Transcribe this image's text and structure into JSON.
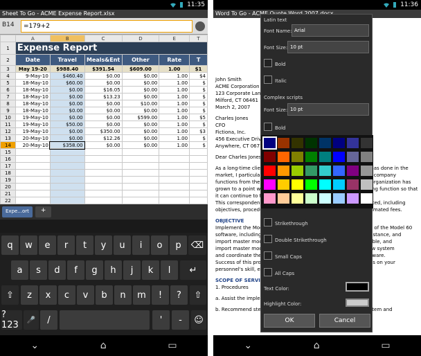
{
  "left": {
    "status_time": "11:35",
    "title": "Sheet To Go - ACME Expense Report.xlsx",
    "cell_ref": "B14",
    "formula": "=179+2",
    "columns": [
      "A",
      "B",
      "C",
      "D",
      "E",
      "T"
    ],
    "rows": [
      {
        "n": "1",
        "c": [
          "Expense Report",
          "",
          "",
          "",
          "",
          ""
        ]
      },
      {
        "n": "2",
        "c": [
          "Date",
          "Travel",
          "Meals&Ent",
          "Other",
          "Rate",
          "T"
        ]
      },
      {
        "n": "3",
        "c": [
          "May 19-20",
          "$988.40",
          "$391.54",
          "$609.00",
          "1.00",
          "$1"
        ]
      },
      {
        "n": "4",
        "c": [
          "9-May-10",
          "$460.40",
          "$0.00",
          "$0.00",
          "1.00",
          "$4"
        ]
      },
      {
        "n": "5",
        "c": [
          "18-May-10",
          "$60.00",
          "$0.00",
          "$0.00",
          "1.00",
          "$"
        ]
      },
      {
        "n": "6",
        "c": [
          "18-May-10",
          "$0.00",
          "$16.05",
          "$0.00",
          "1.00",
          "$"
        ]
      },
      {
        "n": "7",
        "c": [
          "18-May-10",
          "$0.00",
          "$13.23",
          "$0.00",
          "1.00",
          "$"
        ]
      },
      {
        "n": "8",
        "c": [
          "18-May-10",
          "$0.00",
          "$0.00",
          "$10.00",
          "1.00",
          "$"
        ]
      },
      {
        "n": "9",
        "c": [
          "18-May-10",
          "$0.00",
          "$0.00",
          "$0.00",
          "1.00",
          "$"
        ]
      },
      {
        "n": "10",
        "c": [
          "19-May-10",
          "$0.00",
          "$0.00",
          "$599.00",
          "1.00",
          "$5"
        ]
      },
      {
        "n": "11",
        "c": [
          "19-May-10",
          "$50.00",
          "$0.00",
          "$0.00",
          "1.00",
          "$"
        ]
      },
      {
        "n": "12",
        "c": [
          "19-May-10",
          "$0.00",
          "$350.00",
          "$0.00",
          "1.00",
          "$3"
        ]
      },
      {
        "n": "13",
        "c": [
          "20-May-10",
          "$0.00",
          "$12.26",
          "$0.00",
          "1.00",
          "$"
        ]
      },
      {
        "n": "14",
        "c": [
          "20-May-10",
          "$358.00",
          "$0.00",
          "$0.00",
          "1.00",
          "$"
        ]
      },
      {
        "n": "15",
        "c": [
          "",
          "",
          "",
          "",
          "",
          ""
        ]
      },
      {
        "n": "16",
        "c": [
          "",
          "",
          "",
          "",
          "",
          ""
        ]
      },
      {
        "n": "17",
        "c": [
          "",
          "",
          "",
          "",
          "",
          ""
        ]
      },
      {
        "n": "18",
        "c": [
          "",
          "",
          "",
          "",
          "",
          ""
        ]
      },
      {
        "n": "19",
        "c": [
          "",
          "",
          "",
          "",
          "",
          ""
        ]
      },
      {
        "n": "20",
        "c": [
          "",
          "",
          "",
          "",
          "",
          ""
        ]
      },
      {
        "n": "21",
        "c": [
          "",
          "",
          "",
          "",
          "",
          ""
        ]
      },
      {
        "n": "22",
        "c": [
          "",
          "",
          "",
          "",
          "",
          ""
        ]
      },
      {
        "n": "23",
        "c": [
          "",
          "",
          "",
          "",
          "",
          ""
        ]
      }
    ],
    "sheet_tab": "Expe...ort",
    "add_tab": "+",
    "keys_row1": [
      "q",
      "w",
      "e",
      "r",
      "t",
      "y",
      "u",
      "i",
      "o",
      "p"
    ],
    "keys_row2": [
      "a",
      "s",
      "d",
      "f",
      "g",
      "h",
      "j",
      "k",
      "l"
    ],
    "keys_row3": [
      "z",
      "x",
      "c",
      "v",
      "b",
      "n",
      "m",
      "!",
      "?"
    ],
    "key_num": "?123",
    "key_slash": "/",
    "key_quote": "'",
    "key_dash": "-"
  },
  "right": {
    "status_time": "11:36",
    "title": "Word To Go - ACME Quote Word 2007.docx",
    "doc_lines": [
      "John Smith",
      "ACME Corporation",
      "123 Corporate Lane",
      "Milford, CT 06461",
      "March 2, 2007",
      "",
      "Charles Jones",
      "CFO",
      "Fictiona, Inc.",
      "456 Executive Drive",
      "Anywhere, CT 06777",
      "",
      "Dear Charles Jones",
      "",
      "As a long-time client, ACME Corporation knows how much work has done in the",
      "market, I particularly value an opportunity to work with you. Our company",
      "functions from the Model 60 software, including the accounting organization has",
      "grown to a point where there will be at your company's accounting function so that",
      "it can continue to function.",
      "This correspondence contains the details of the work you requested, including",
      "objectives, procedures, scope of services, requirements, and estimated fees.",
      "",
      "OBJECTIVE",
      "Implement the Model 60 software within the accounting function of the Model 60",
      "software, including software installation, installation and the assistance, and",
      "import master module conversion support for the accounts payable, and",
      "import master modules conversion support and accounts the new system",
      "and coordinate the implementation with your existing ACME software.",
      "Success of this project depends on the cooperation and readiness on your",
      "personnel's skill, effort and commitment to the new system.",
      "",
      "SCOPE OF SERVICES",
      "1.  Procedures",
      "",
      "a.  Assist the implementation and the new accounting system.",
      "",
      "b.  Recommend steps required to successfully install the new system and"
    ],
    "dlg": {
      "latin": "Latin text",
      "font_name_label": "Font Name:",
      "font_name": "Arial",
      "font_size_label": "Font Size:",
      "font_size": "10 pt",
      "bold": "Bold",
      "italic": "Italic",
      "complex": "Complex scripts",
      "cs_size_label": "Font Size:",
      "cs_size": "10 pt",
      "cs_bold": "Bold",
      "strike": "Strikethrough",
      "dstrike": "Double Strikethrough",
      "smallcaps": "Small Caps",
      "allcaps": "All Caps",
      "textcolor": "Text Color:",
      "highlight": "Highlight Color:",
      "ok": "OK",
      "cancel": "Cancel"
    },
    "palette": [
      [
        "#000080",
        "#993300",
        "#333300",
        "#003300",
        "#003366",
        "#000080",
        "#333399",
        "#333333"
      ],
      [
        "#800000",
        "#ff6600",
        "#808000",
        "#008000",
        "#008080",
        "#0000ff",
        "#666699",
        "#808080"
      ],
      [
        "#ff0000",
        "#ff9900",
        "#99cc00",
        "#339966",
        "#33cccc",
        "#3366ff",
        "#800080",
        "#969696"
      ],
      [
        "#ff00ff",
        "#ffcc00",
        "#ffff00",
        "#00ff00",
        "#00ffff",
        "#00ccff",
        "#993366",
        "#c0c0c0"
      ],
      [
        "#ff99cc",
        "#ffcc99",
        "#ffff99",
        "#ccffcc",
        "#ccffff",
        "#99ccff",
        "#cc99ff",
        "#ffffff"
      ]
    ]
  }
}
